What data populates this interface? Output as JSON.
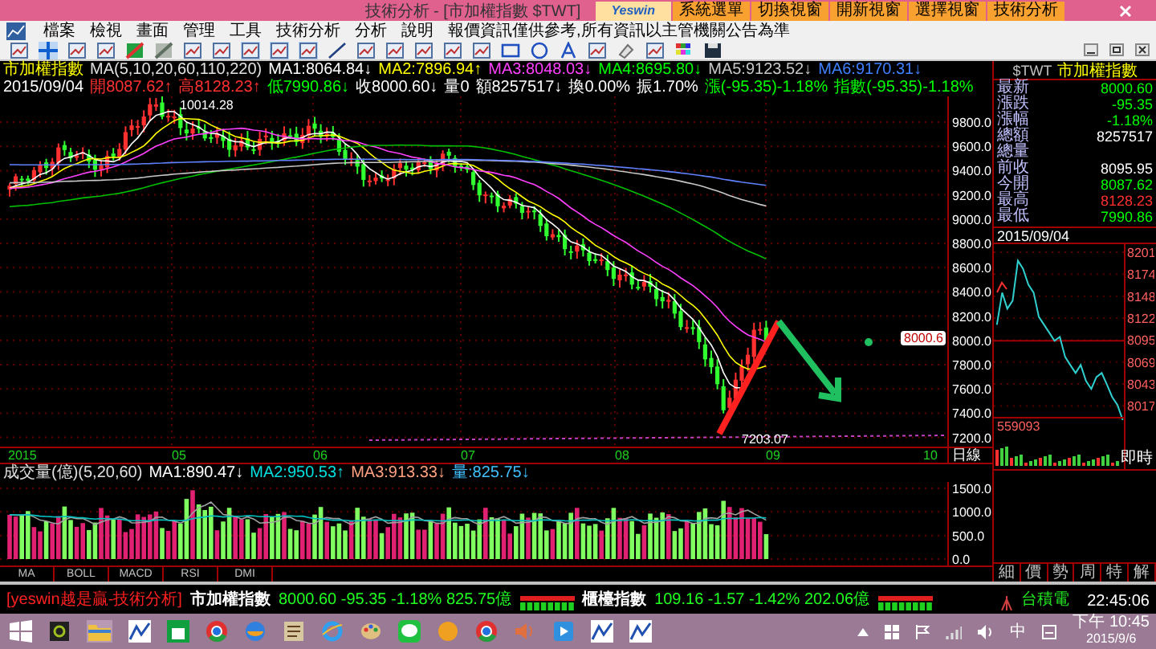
{
  "window": {
    "title": "技術分析 - [市加權指數 $TWT]",
    "brand": "Yeswin",
    "title_buttons": [
      "系統選單",
      "切換視窗",
      "開新視窗",
      "選擇視窗",
      "技術分析"
    ]
  },
  "menu": [
    "檔案",
    "檢視",
    "畫面",
    "管理",
    "工具",
    "技術分析",
    "分析",
    "說明"
  ],
  "notice": "報價資訊僅供參考,所有資訊以主管機關公告為準",
  "info_line1": [
    {
      "text": "市加權指數",
      "color": "#ffff00"
    },
    {
      "text": "MA(5,10,20,60,110,220)",
      "color": "#e0e0e0"
    },
    {
      "text": "MA1:8064.84↓",
      "color": "#ffffff"
    },
    {
      "text": "MA2:7896.94↑",
      "color": "#ffff00"
    },
    {
      "text": "MA3:8048.03↓",
      "color": "#ff40ff"
    },
    {
      "text": "MA4:8695.80↓",
      "color": "#00ff00"
    },
    {
      "text": "MA5:9123.52↓",
      "color": "#c8c8c8"
    },
    {
      "text": "MA6:9170.31↓",
      "color": "#4080ff"
    }
  ],
  "info_line2": [
    {
      "text": "2015/09/04",
      "color": "#ffffff"
    },
    {
      "text": "開8087.62↑",
      "color": "#ff3030"
    },
    {
      "text": "高8128.23↑",
      "color": "#ff3030"
    },
    {
      "text": "低7990.86↓",
      "color": "#00ff00"
    },
    {
      "text": "收8000.60↓",
      "color": "#ffffff"
    },
    {
      "text": "量0",
      "color": "#ffffff"
    },
    {
      "text": "額8257517↓",
      "color": "#ffffff"
    },
    {
      "text": "換0.00%",
      "color": "#ffffff"
    },
    {
      "text": "振1.70%",
      "color": "#ffffff"
    },
    {
      "text": "漲(-95.35)-1.18%",
      "color": "#00ff00"
    },
    {
      "text": "指數(-95.35)-1.18%",
      "color": "#00ff00"
    }
  ],
  "price_axis": [
    "9800.0",
    "9600.0",
    "9400.0",
    "9200.0",
    "9000.0",
    "8800.0",
    "8600.0",
    "8400.0",
    "8200.0",
    "8000.0",
    "7800.0",
    "7600.0",
    "7400.0",
    "7200.0"
  ],
  "price_marker": "8000.6",
  "high_label": "10014.28",
  "low_label": "7203.07",
  "date_axis": [
    "2015",
    "05",
    "06",
    "07",
    "08",
    "09",
    "10"
  ],
  "period": "日線",
  "volume_header": [
    {
      "text": "成交量(億)(5,20,60)",
      "color": "#e0e0e0"
    },
    {
      "text": "MA1:890.47↓",
      "color": "#ffffff"
    },
    {
      "text": "MA2:950.53↑",
      "color": "#00e0e0"
    },
    {
      "text": "MA3:913.33↓",
      "color": "#ffa080"
    },
    {
      "text": "量:825.75↓",
      "color": "#40c0ff"
    }
  ],
  "volume_axis": [
    "1500.0",
    "1000.0",
    "500.0",
    "0.0"
  ],
  "indicator_tabs": [
    "MA",
    "BOLL",
    "MACD",
    "RSI",
    "DMI"
  ],
  "quote": {
    "symbol": "$TWT",
    "name": "市加權指數",
    "date": "2015/09/04",
    "rows": [
      {
        "label": "最新",
        "value": "8000.60",
        "color": "#00ff00"
      },
      {
        "label": "漲跌",
        "value": "-95.35",
        "color": "#00ff00"
      },
      {
        "label": "漲幅",
        "value": "-1.18%",
        "color": "#00ff00"
      },
      {
        "label": "總額",
        "value": "8257517",
        "color": "#ffffff"
      },
      {
        "label": "總量"
      },
      {
        "label": "前收",
        "value": "8095.95",
        "color": "#ffffff"
      },
      {
        "label": "今開",
        "value": "8087.62",
        "color": "#00ff00"
      },
      {
        "label": "最高",
        "value": "8128.23",
        "color": "#ff3030"
      },
      {
        "label": "最低",
        "value": "7990.86",
        "color": "#00ff00"
      }
    ]
  },
  "mini_axis": [
    "8201",
    "8174",
    "8148",
    "8122",
    "8095",
    "8069",
    "8043",
    "8017"
  ],
  "mini_volume": "559093",
  "mini_mode": "即時",
  "quote_tabs": [
    "細",
    "價",
    "勢",
    "周",
    "特",
    "解"
  ],
  "ticker": {
    "brand": "[yeswin越是贏-技術分析]",
    "items": [
      {
        "name": "市加權指數",
        "values": "8000.60 -95.35 -1.18% 825.75億"
      },
      {
        "name": "櫃檯指數",
        "values": "109.16 -1.57 -1.42% 202.06億"
      }
    ],
    "stock": "台積電",
    "time": "22:45:06"
  },
  "taskbar": {
    "ime": "中",
    "time": "下午 10:45",
    "date": "2015/9/6"
  }
}
